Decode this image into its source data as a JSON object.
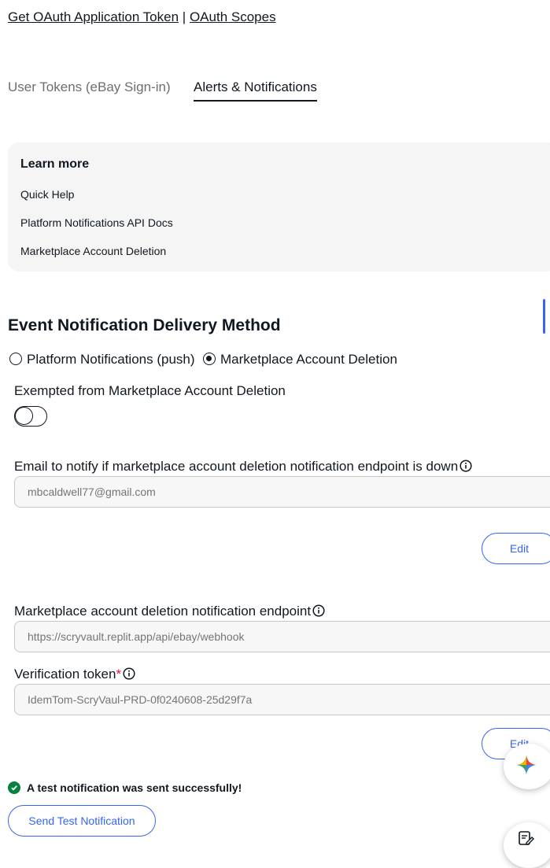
{
  "links": {
    "get_token": "Get OAuth Application Token",
    "separator": "|",
    "scopes": "OAuth Scopes"
  },
  "tabs": [
    {
      "label": "User Tokens (eBay Sign-in)",
      "active": false
    },
    {
      "label": "Alerts & Notifications",
      "active": true
    }
  ],
  "learn_more": {
    "title": "Learn more",
    "links": [
      "Quick Help",
      "Platform Notifications API Docs",
      "Marketplace Account Deletion"
    ]
  },
  "delivery": {
    "title": "Event Notification Delivery Method",
    "options": [
      {
        "label": "Platform Notifications (push)",
        "selected": false
      },
      {
        "label": "Marketplace Account Deletion",
        "selected": true
      }
    ]
  },
  "exemption": {
    "label": "Exempted from Marketplace Account Deletion",
    "toggle_on": false
  },
  "email_section": {
    "label": "Email to notify if marketplace account deletion notification endpoint is down",
    "placeholder": "mbcaldwell77@gmail.com",
    "edit_label": "Edit"
  },
  "endpoint_section": {
    "endpoint_label": "Marketplace account deletion notification endpoint",
    "endpoint_placeholder": "https://scryvault.replit.app/api/ebay/webhook",
    "token_label": "Verification token",
    "token_required_mark": "*",
    "token_placeholder": "IdemTom-ScryVaul-PRD-0f0240608-25d29f7a",
    "edit_label": "Edit"
  },
  "status": {
    "success_message": "A test notification was sent successfully!"
  },
  "send_test_label": "Send Test Notification",
  "colors": {
    "accent": "#3665f3",
    "success": "#05823f",
    "required": "#e0103a"
  },
  "icons": [
    "info-icon",
    "check-circle-icon",
    "sparkle-icon",
    "note-edit-icon"
  ]
}
